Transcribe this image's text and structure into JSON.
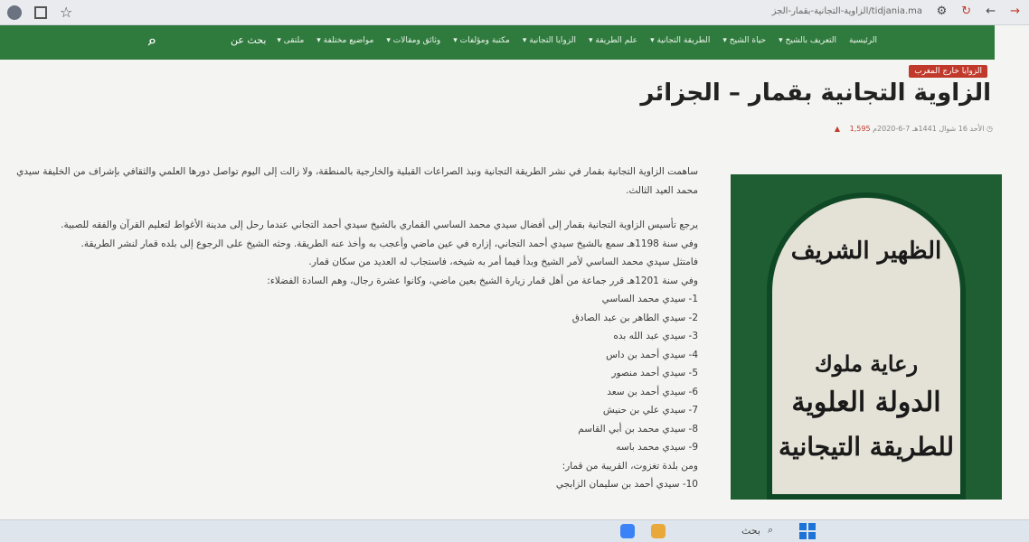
{
  "browser": {
    "url": "tidjania.ma/الزاوية-التجانية-بقمار-الجز",
    "star_icon": "star-icon"
  },
  "nav": {
    "items": [
      "الرئيسية",
      "التعريف بالشيخ ▾",
      "حياة الشيخ ▾",
      "الطريقة التجانية ▾",
      "علم الطريقة ▾",
      "الزوايا التجانية ▾",
      "مكتبة ومؤلفات ▾",
      "وثائق ومقالات ▾",
      "مواضيع مختلفة ▾",
      "ملتقى ▾"
    ],
    "search_label": "بحث عن",
    "search_icon": "search-icon"
  },
  "article": {
    "category_tag": "الزوايا خارج المغرب",
    "title": "الزاوية التجانية بقمار – الجزائر",
    "meta_date": "الأحد 16 شوال 1441هـ 7-6-2020م",
    "meta_views": "1,595",
    "paragraphs": [
      "ساهمت الزاوية التجانية بقمار في نشر الطريقة التجانية ونبذ الصراعات القبلية والخارجية بالمنطقة، ولا زالت إلى اليوم تواصل دورها العلمي والثقافي بإشراف من الخليفة سيدي محمد العيد الثالث."
    ],
    "paragraphs2": [
      "يرجع تأسيس الزاوية التجانية بقمار إلى أفضال سيدي محمد الساسي القماري بالشيخ سيدي أحمد التجاني عندما رحل إلى مدينة الأغواط لتعليم القرآن والفقه للصبية.",
      "وفي سنة 1198هـ سمع بالشيخ سيدي أحمد التجاني، إزاره في عين ماضي وأعجب به وأخذ عنه الطريقة. وحثه الشيخ على الرجوع إلى بلده قمار لنشر الطريقة.",
      "فامتثل سيدي محمد الساسي لأمر الشيخ وبدأ فيما أمر به شيخه، فاستجاب له العديد من سكان قمار.",
      "وفي سنة 1201هـ قرر جماعة من أهل قمار زيارة الشيخ بعين ماضي، وكانوا عشرة رجال، وهم السادة الفضلاء:"
    ],
    "list": [
      "1- سيدي محمد الساسي",
      "2- سيدي الطاهر بن عبد الصادق",
      "3- سيدي عبد الله بده",
      "4- سيدي أحمد بن داس",
      "5- سيدي أحمد منصور",
      "6- سيدي أحمد بن سعد",
      "7- سيدي علي بن حنيش",
      "8- سيدي محمد بن أبي القاسم",
      "9- سيدي محمد باسه",
      "ومن بلدة تغزوت، القريبة من قمار:",
      "10- سيدي أحمد بن سليمان الزابجي"
    ]
  },
  "sidebar_image": {
    "line1": "الظهير الشريف",
    "line2": "رعاية ملوك",
    "line3": "الدولة العلوية",
    "line4": "للطريقة التيجانية"
  },
  "taskbar": {
    "search_label": "بحث",
    "search_icon": "search-icon",
    "windows_icon": "windows-start-icon"
  }
}
